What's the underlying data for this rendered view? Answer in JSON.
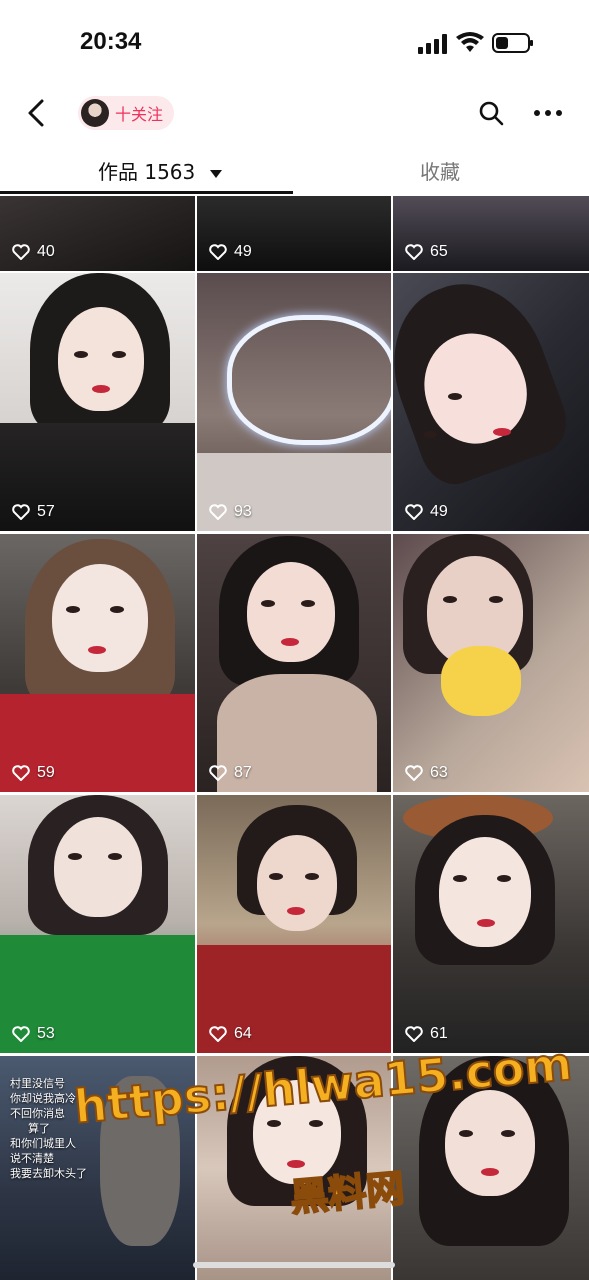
{
  "status_bar": {
    "time": "20:34"
  },
  "nav": {
    "follow_label": "十关注"
  },
  "tabs": {
    "works_label": "作品",
    "works_count": "1563",
    "favorites_label": "收藏"
  },
  "grid": {
    "likes": [
      "40",
      "49",
      "65",
      "57",
      "93",
      "49",
      "59",
      "87",
      "63",
      "53",
      "64",
      "61"
    ]
  },
  "overlay": {
    "lines": [
      "村里没信号",
      "你却说我高冷",
      "不回你消息",
      "算了",
      "和你们城里人",
      "说不清楚",
      "我要去卸木头了"
    ]
  },
  "watermark": {
    "url": "https://hlwa15.com",
    "site_name": "黑料网"
  },
  "colors": {
    "accent": "#f0315a",
    "pill_bg": "#fbe9ec",
    "watermark": "#f5b021"
  },
  "icons": [
    "back-icon",
    "search-icon",
    "more-icon",
    "heart-icon",
    "signal-icon",
    "wifi-icon",
    "battery-icon"
  ]
}
